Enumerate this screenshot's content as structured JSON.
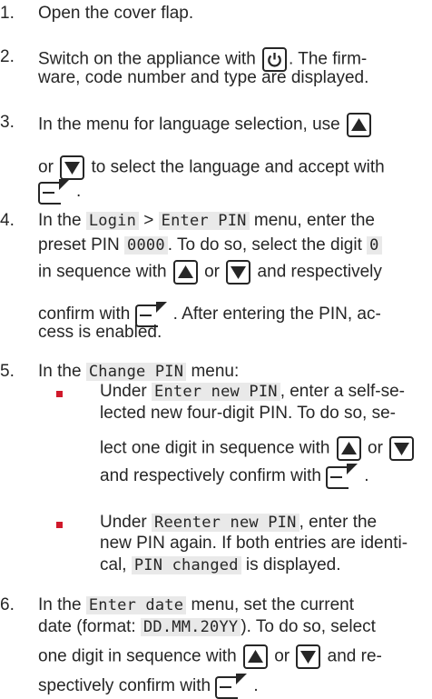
{
  "steps": [
    {
      "number": "1.",
      "lines": [
        [
          "Open the cover flap."
        ]
      ]
    },
    {
      "number": "2.",
      "lines": [
        [
          "Switch on the appliance with ",
          {
            "icon": "power"
          },
          ". The firm-"
        ],
        [
          "ware, code number and type are displayed."
        ]
      ]
    },
    {
      "number": "3.",
      "lines": [
        [
          "In the menu for language selection, use ",
          {
            "icon": "up"
          }
        ],
        [
          "or ",
          {
            "icon": "down"
          },
          " to select the language and accept with"
        ],
        [
          {
            "icon": "enter"
          },
          "."
        ]
      ]
    },
    {
      "number": "4.",
      "lines": [
        [
          "In the ",
          {
            "code": "Login"
          },
          " > ",
          {
            "code": "Enter PIN"
          },
          " menu, enter the"
        ],
        [
          "preset PIN ",
          {
            "code": "0000"
          },
          ". To do so, select the digit ",
          {
            "code": "0"
          }
        ],
        [
          "in sequence with ",
          {
            "icon": "up"
          },
          " or ",
          {
            "icon": "down"
          },
          " and respectively"
        ],
        [
          "confirm with ",
          {
            "icon": "enter"
          },
          ". After entering the PIN, ac-"
        ],
        [
          "cess is enabled."
        ]
      ]
    },
    {
      "number": "5.",
      "lines": [
        [
          "In the ",
          {
            "code": "Change PIN"
          },
          " menu:"
        ]
      ]
    },
    {
      "number": "",
      "bullet": true,
      "lines": [
        [
          "Under ",
          {
            "code": "Enter new PIN"
          },
          ", enter a self-se-"
        ],
        [
          "lected new four-digit PIN. To do so, se-"
        ],
        [
          "lect one digit in sequence with ",
          {
            "icon": "up"
          },
          " or ",
          {
            "icon": "down"
          }
        ],
        [
          "and respectively confirm with ",
          {
            "icon": "enter"
          },
          "."
        ]
      ]
    },
    {
      "number": "",
      "bullet": true,
      "lines": [
        [
          "Under ",
          {
            "code": "Reenter new PIN"
          },
          ", enter the"
        ],
        [
          "new PIN again. If both entries are identi-"
        ],
        [
          "cal, ",
          {
            "code": "PIN changed"
          },
          " is displayed."
        ]
      ]
    },
    {
      "number": "6.",
      "lines": [
        [
          "In the ",
          {
            "code": "Enter date"
          },
          " menu, set the current"
        ],
        [
          "date (format: ",
          {
            "code": "DD.MM.20YY"
          },
          "). To do so, select"
        ],
        [
          "one digit in sequence with ",
          {
            "icon": "up"
          },
          " or ",
          {
            "icon": "down"
          },
          " and re-"
        ],
        [
          "spectively confirm with ",
          {
            "icon": "enter"
          },
          "."
        ]
      ]
    }
  ]
}
